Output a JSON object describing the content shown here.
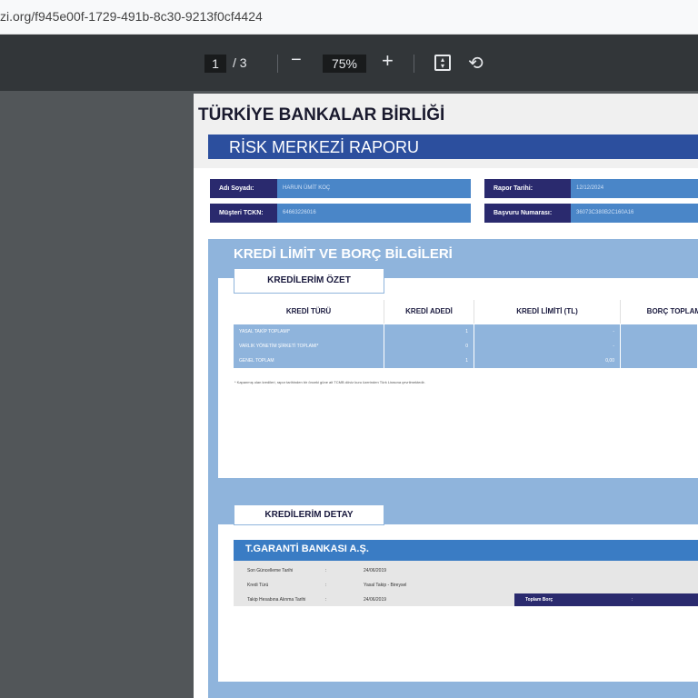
{
  "browser": {
    "url": "zi.org/f945e00f-1729-491b-8c30-9213f0cf4424"
  },
  "viewer": {
    "page_current": "1",
    "page_total": "/ 3",
    "zoom": "75%",
    "zoom_out": "−",
    "zoom_in": "+",
    "fit_icon": "fit-page-icon",
    "rotate_icon": "rotate-icon"
  },
  "doc": {
    "org": "TÜRKİYE BANKALAR BİRLİĞİ",
    "report_title": "RİSK MERKEZİ RAPORU",
    "info": {
      "name_label": "Adı Soyadı:",
      "name_value": "HARUN ÜMİT KOÇ",
      "tckn_label": "Müşteri TCKN:",
      "tckn_value": "64663226016",
      "date_label": "Rapor Tarihi:",
      "date_value": "12/12/2024",
      "app_label": "Başvuru Numarası:",
      "app_value": "36073C380B2C160A16"
    },
    "section_title": "KREDİ LİMİT VE BORÇ BİLGİLERİ",
    "summary_tab": "KREDİLERİM ÖZET",
    "summary_table": {
      "headers": [
        "KREDİ TÜRÜ",
        "KREDİ ADEDİ",
        "KREDİ LİMİTİ (TL)",
        "BORÇ TOPLAMI"
      ],
      "rows": [
        [
          "YASAL TAKİP TOPLAMI*",
          "1",
          "-",
          ""
        ],
        [
          "VARLIK YÖNETİM ŞİRKETİ TOPLAMI*",
          "0",
          "-",
          ""
        ],
        [
          "GENEL TOPLAM",
          "1",
          "0,00",
          ""
        ]
      ]
    },
    "footnote": "* Kapanmış olan kredileri, rapor tarihinden bir önceki güne ait TCMB döviz kuru üzerinden Türk Lirasına çevrilmektedir.",
    "detail_tab": "KREDİLERİM DETAY",
    "bank": {
      "name": "T.GARANTİ BANKASI  A.Ş.",
      "rows": [
        {
          "label": "Son Güncelleme Tarihi",
          "sep": ":",
          "value": "24/06/2019"
        },
        {
          "label": "Kredi Türü",
          "sep": ":",
          "value": "Yasal Takip - Bireysel"
        },
        {
          "label": "Takip Hesabına Alınma Tarihi",
          "sep": ":",
          "value": "24/06/2019"
        }
      ],
      "total_label": "Toplam Borç",
      "total_sep": ":"
    }
  }
}
